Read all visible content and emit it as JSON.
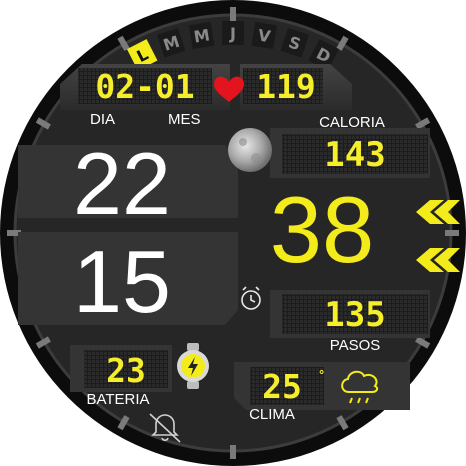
{
  "weekdays": {
    "items": [
      "L",
      "M",
      "M",
      "J",
      "V",
      "S",
      "D"
    ],
    "active_index": 0
  },
  "date": {
    "value": "02-01",
    "day_label": "DIA",
    "month_label": "MES"
  },
  "heart_rate": {
    "value": "119",
    "icon": "heart-icon"
  },
  "time": {
    "hours": "22",
    "minutes": "15",
    "seconds": "38"
  },
  "calories": {
    "value": "143",
    "label": "CALORIA"
  },
  "steps": {
    "value": "135",
    "label": "PASOS"
  },
  "battery": {
    "value": "23",
    "label": "BATERIA",
    "icon": "watch-battery-icon"
  },
  "weather": {
    "temperature": "25",
    "unit_mark": "°",
    "label": "CLIMA",
    "icon": "rain-cloud-icon"
  },
  "icons": {
    "moon": "moon-phase-icon",
    "alarm": "alarm-clock-icon",
    "mute": "bell-off-icon"
  },
  "colors": {
    "accent": "#f3ec1a",
    "background": "#232323",
    "bezel": "#101010",
    "panel": "#3a3a3a"
  }
}
